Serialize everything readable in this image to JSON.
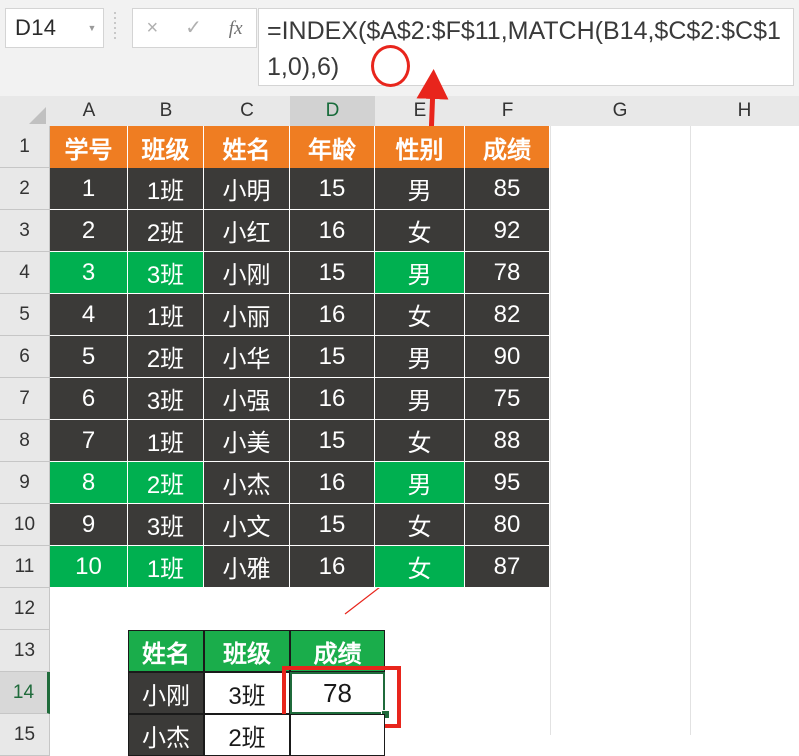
{
  "app": "excel-spreadsheet",
  "formula_bar": {
    "name_box_value": "D14",
    "name_box_dropdown_icon": "chevron-down-icon",
    "cancel_icon": "×",
    "confirm_icon": "✓",
    "function_icon": "fx",
    "formula": "=INDEX($A$2:$F$11,MATCH(B14,$C$2:$C$11,0),6)"
  },
  "grid": {
    "column_headers": [
      "A",
      "B",
      "C",
      "D",
      "E",
      "F",
      "G",
      "H"
    ],
    "selected_column": "D",
    "row_headers": [
      "1",
      "2",
      "3",
      "4",
      "5",
      "6",
      "7",
      "8",
      "9",
      "10",
      "11",
      "12",
      "13",
      "14",
      "15"
    ],
    "selected_row": "14"
  },
  "main_table": {
    "headers": [
      "学号",
      "班级",
      "姓名",
      "年龄",
      "性别",
      "成绩"
    ],
    "header_bg": "#ef7d22",
    "cell_bg": "#3b3a38",
    "highlight_bg": "#00b050",
    "rows": [
      {
        "row": "2",
        "values": [
          "1",
          "1班",
          "小明",
          "15",
          "男",
          "85"
        ],
        "highlight": []
      },
      {
        "row": "3",
        "values": [
          "2",
          "2班",
          "小红",
          "16",
          "女",
          "92"
        ],
        "highlight": []
      },
      {
        "row": "4",
        "values": [
          "3",
          "3班",
          "小刚",
          "15",
          "男",
          "78"
        ],
        "highlight": [
          1,
          2,
          5
        ]
      },
      {
        "row": "5",
        "values": [
          "4",
          "1班",
          "小丽",
          "16",
          "女",
          "82"
        ],
        "highlight": []
      },
      {
        "row": "6",
        "values": [
          "5",
          "2班",
          "小华",
          "15",
          "男",
          "90"
        ],
        "highlight": []
      },
      {
        "row": "7",
        "values": [
          "6",
          "3班",
          "小强",
          "16",
          "男",
          "75"
        ],
        "highlight": []
      },
      {
        "row": "8",
        "values": [
          "7",
          "1班",
          "小美",
          "15",
          "女",
          "88"
        ],
        "highlight": []
      },
      {
        "row": "9",
        "values": [
          "8",
          "2班",
          "小杰",
          "16",
          "男",
          "95"
        ],
        "highlight": [
          1,
          2,
          5
        ]
      },
      {
        "row": "10",
        "values": [
          "9",
          "3班",
          "小文",
          "15",
          "女",
          "80"
        ],
        "highlight": []
      },
      {
        "row": "11",
        "values": [
          "10",
          "1班",
          "小雅",
          "16",
          "女",
          "87"
        ],
        "highlight": [
          1,
          2,
          5
        ]
      }
    ]
  },
  "lookup_table": {
    "headers": [
      "姓名",
      "班级",
      "成绩"
    ],
    "header_bg": "#1aad4b",
    "rows": [
      {
        "row": "14",
        "name": "小刚",
        "class": "3班",
        "score": "78"
      },
      {
        "row": "15",
        "name": "小杰",
        "class": "2班",
        "score": ""
      }
    ]
  },
  "annotations": {
    "circle_target": ",6)",
    "accent_color": "#e8251c",
    "arrow": "red-up-arrow",
    "highlight_rect": "red-rectangle-around-D14"
  }
}
